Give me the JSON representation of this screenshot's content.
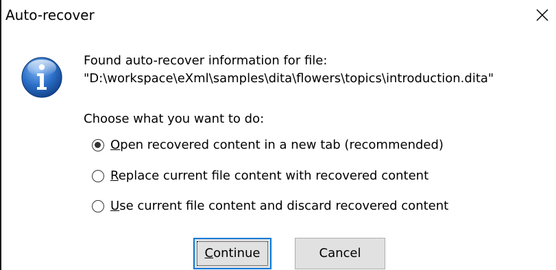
{
  "window": {
    "title": "Auto-recover",
    "close_icon": "close-icon"
  },
  "message": {
    "icon": "info-icon",
    "line1": "Found auto-recover information for file:",
    "line2": "\"D:\\workspace\\eXml\\samples\\dita\\flowers\\topics\\introduction.dita\""
  },
  "options": {
    "prompt": "Choose what you want to do:",
    "items": [
      {
        "mnemonic": "O",
        "rest": "pen recovered content in a new tab (recommended)",
        "selected": true
      },
      {
        "mnemonic": "R",
        "rest": "eplace current file content with recovered content",
        "selected": false
      },
      {
        "mnemonic": "U",
        "rest": "se current file content and discard recovered content",
        "selected": false
      }
    ]
  },
  "buttons": {
    "continue": {
      "mnemonic": "C",
      "rest": "ontinue"
    },
    "cancel": "Cancel"
  },
  "colors": {
    "focus_border": "#0078d7",
    "button_face": "#e1e1e1",
    "info_icon_blue": "#2b6fc7"
  }
}
